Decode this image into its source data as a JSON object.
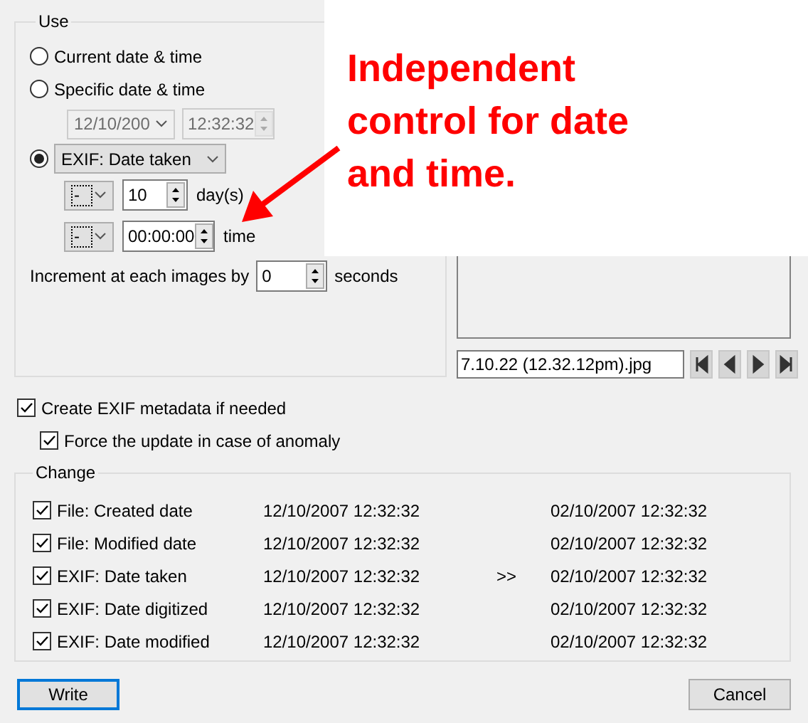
{
  "use": {
    "title": "Use",
    "radios": [
      {
        "kind": "plain",
        "label": "Current date & time",
        "selected": false
      },
      {
        "kind": "plain",
        "label": "Specific date & time",
        "selected": false
      },
      {
        "kind": "dropdown",
        "label": "EXIF: Date taken",
        "selected": true
      }
    ],
    "specific": {
      "date": "12/10/200",
      "time": "12:32:32",
      "disabled": true
    },
    "offsets": [
      {
        "sign": "-",
        "value": "10",
        "unit": "day(s)"
      },
      {
        "sign": "-",
        "value": "00:00:00",
        "unit": "time"
      }
    ],
    "increment": {
      "label": "Increment at each images by",
      "value": "0",
      "unit": "seconds"
    }
  },
  "preview": {
    "filename": "7.10.22 (12.32.12pm).jpg"
  },
  "annotation": {
    "text": "Independent control for date and time."
  },
  "options": [
    {
      "label": "Create EXIF metadata if needed",
      "checked": true
    },
    {
      "label": "Force the update in case of anomaly",
      "checked": true
    }
  ],
  "change": {
    "title": "Change",
    "rows": [
      {
        "label": "File: Created date",
        "checked": true,
        "current": "12/10/2007 12:32:32",
        "new": "02/10/2007 12:32:32"
      },
      {
        "label": "File: Modified date",
        "checked": true,
        "current": "12/10/2007 12:32:32",
        "new": "02/10/2007 12:32:32"
      },
      {
        "label": "EXIF: Date taken",
        "checked": true,
        "current": "12/10/2007 12:32:32",
        "marker": ">>",
        "new": "02/10/2007 12:32:32"
      },
      {
        "label": "EXIF: Date digitized",
        "checked": true,
        "current": "12/10/2007 12:32:32",
        "new": "02/10/2007 12:32:32"
      },
      {
        "label": "EXIF: Date modified",
        "checked": true,
        "current": "12/10/2007 12:32:32",
        "new": "02/10/2007 12:32:32"
      }
    ]
  },
  "buttons": [
    {
      "label": "Write",
      "focused": true
    },
    {
      "label": "Cancel",
      "focused": false
    }
  ]
}
